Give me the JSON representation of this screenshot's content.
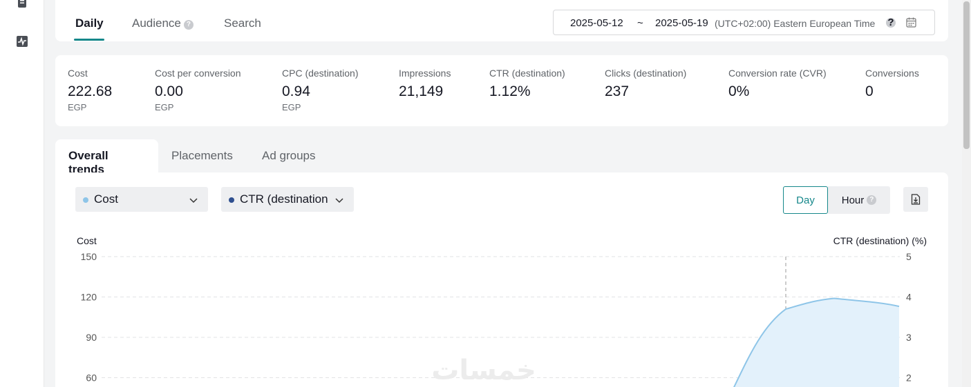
{
  "top_tabs": [
    {
      "label": "Daily"
    },
    {
      "label": "Audience"
    },
    {
      "label": "Search"
    }
  ],
  "help_icon_glyph": "?",
  "date_range": {
    "start": "2025-05-12",
    "separator": "~",
    "end": "2025-05-19",
    "timezone": "(UTC+02:00) Eastern European Time"
  },
  "metrics": [
    {
      "label": "Cost",
      "value": "222.68",
      "unit": "EGP"
    },
    {
      "label": "Cost per conversion",
      "value": "0.00",
      "unit": "EGP"
    },
    {
      "label": "CPC (destination)",
      "value": "0.94",
      "unit": "EGP"
    },
    {
      "label": "Impressions",
      "value": "21,149",
      "unit": ""
    },
    {
      "label": "CTR (destination)",
      "value": "1.12%",
      "unit": ""
    },
    {
      "label": "Clicks (destination)",
      "value": "237",
      "unit": ""
    },
    {
      "label": "Conversion rate (CVR)",
      "value": "0%",
      "unit": ""
    },
    {
      "label": "Conversions",
      "value": "0",
      "unit": ""
    }
  ],
  "trend_tabs": [
    {
      "label": "Overall trends"
    },
    {
      "label": "Placements"
    },
    {
      "label": "Ad groups"
    }
  ],
  "selectors": {
    "primary": {
      "label": "Cost",
      "dot_color": "#8ec5e8"
    },
    "secondary": {
      "label": "CTR (destination",
      "dot_color": "#2f4f8f"
    }
  },
  "granularity": {
    "day": "Day",
    "hour": "Hour"
  },
  "icons": {
    "calendar": "calendar-icon",
    "chevron": "chevron-down-icon",
    "export": "export-icon",
    "help": "help-icon",
    "document": "document-icon",
    "activity": "activity-icon"
  },
  "colors": {
    "accent": "#15878a",
    "cost_line": "#8ec5e8",
    "cost_fill": "#e3f1fb"
  },
  "chart_data": {
    "type": "area",
    "ylabel_left": "Cost",
    "ylabel_right": "CTR (destination) (%)",
    "left_ticks": [
      150,
      120,
      90,
      60
    ],
    "right_ticks": [
      5,
      4,
      3,
      2
    ],
    "ylim_left": [
      0,
      150
    ],
    "ylim_right": [
      0,
      5
    ],
    "grid": true,
    "series": [
      {
        "name": "Cost",
        "values": [
          55,
          111,
          119,
          113
        ]
      }
    ]
  },
  "watermark": "خمسات"
}
